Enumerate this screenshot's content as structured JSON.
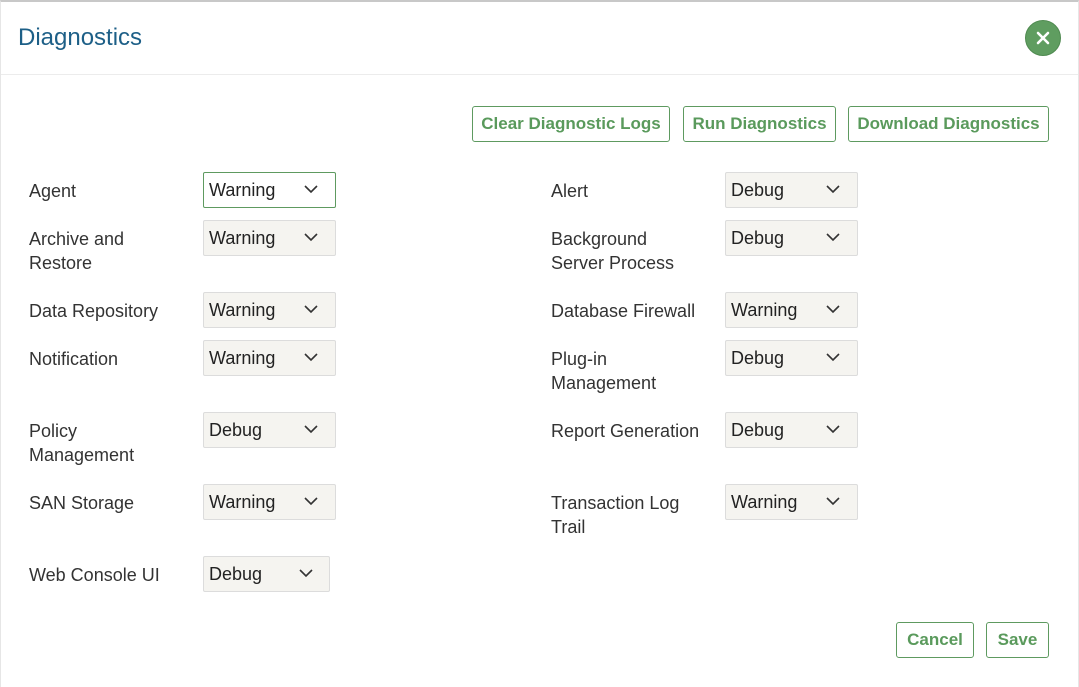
{
  "dialog": {
    "title": "Diagnostics"
  },
  "actions": {
    "clear_label": "Clear Diagnostic Logs",
    "run_label": "Run Diagnostics",
    "download_label": "Download Diagnostics"
  },
  "fields": [
    {
      "label": "Agent",
      "value": "Warning"
    },
    {
      "label": "Alert",
      "value": "Debug"
    },
    {
      "label": "Archive and Restore",
      "value": "Warning"
    },
    {
      "label": "Background Server Process",
      "value": "Debug"
    },
    {
      "label": "Data Repository",
      "value": "Warning"
    },
    {
      "label": "Database Firewall",
      "value": "Warning"
    },
    {
      "label": "Notification",
      "value": "Warning"
    },
    {
      "label": "Plug-in Management",
      "value": "Debug"
    },
    {
      "label": "Policy Management",
      "value": "Debug"
    },
    {
      "label": "Report Generation",
      "value": "Debug"
    },
    {
      "label": "SAN Storage",
      "value": "Warning"
    },
    {
      "label": "Transaction Log Trail",
      "value": "Warning"
    },
    {
      "label": "Web Console UI",
      "value": "Debug"
    }
  ],
  "footer": {
    "cancel_label": "Cancel",
    "save_label": "Save"
  },
  "colors": {
    "title": "#1d5f87",
    "accent_green": "#5f9d60",
    "select_bg": "#f5f4f0"
  },
  "icons": {
    "close": "close-icon",
    "dropdown": "chevron-down-icon"
  }
}
